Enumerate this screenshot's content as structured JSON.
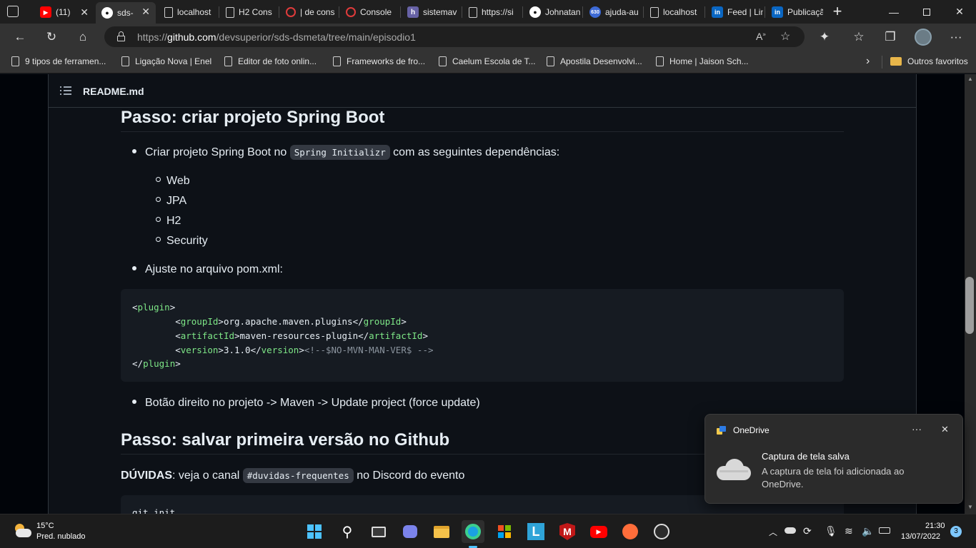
{
  "tabs": [
    {
      "label": "(11)",
      "icon": "youtube-icon",
      "color": "#ff0000"
    },
    {
      "label": "sds-",
      "icon": "github-icon",
      "color": "#ffffff",
      "active": true
    },
    {
      "label": "localhost",
      "icon": "page-icon"
    },
    {
      "label": "H2 Cons",
      "icon": "page-icon"
    },
    {
      "label": "| de cons",
      "icon": "devsuperior-icon",
      "color": "#e03b3b"
    },
    {
      "label": "Console",
      "icon": "devsuperior-icon",
      "color": "#e03b3b"
    },
    {
      "label": "sistemav",
      "icon": "heroku-icon",
      "color": "#6762a6"
    },
    {
      "label": "https://si",
      "icon": "page-icon"
    },
    {
      "label": "Johnatan",
      "icon": "github-icon",
      "color": "#ffffff"
    },
    {
      "label": "ajuda-au",
      "icon": "badge-630-icon",
      "color": "#3d6ad6",
      "badge": "630"
    },
    {
      "label": "localhost",
      "icon": "page-icon"
    },
    {
      "label": "Feed | Lin",
      "icon": "linkedin-icon",
      "color": "#0a66c2"
    },
    {
      "label": "Publicaçã",
      "icon": "linkedin-icon",
      "color": "#0a66c2"
    }
  ],
  "address": {
    "prefix": "https://",
    "domain": "github.com",
    "path": "/devsuperior/sds-dsmeta/tree/main/episodio1"
  },
  "favorites": [
    "9 tipos de ferramen...",
    "Ligação Nova | Enel",
    "Editor de foto onlin...",
    "Frameworks de fro...",
    "Caelum Escola de T...",
    "Apostila Desenvolvi...",
    "Home | Jaison Sch..."
  ],
  "favorites_other": "Outros favoritos",
  "readme": {
    "filename": "README.md",
    "section1": {
      "heading": "Passo: criar projeto Spring Boot",
      "item1_pre": "Criar projeto Spring Boot no ",
      "item1_code": "Spring Initializr",
      "item1_post": " com as seguintes dependências:",
      "deps": [
        "Web",
        "JPA",
        "H2",
        "Security"
      ],
      "item2": "Ajuste no arquivo pom.xml:",
      "code": {
        "plugin_open": "plugin",
        "group_tag": "groupId",
        "group_val": "org.apache.maven.plugins",
        "artifact_tag": "artifactId",
        "artifact_val": "maven-resources-plugin",
        "version_tag": "version",
        "version_val": "3.1.0",
        "comment": "<!--$NO-MVN-MAN-VER$ -->"
      },
      "item3": "Botão direito no projeto -> Maven -> Update project (force update)"
    },
    "section2": {
      "heading": "Passo: salvar primeira versão no Github",
      "doubts_bold": "DÚVIDAS",
      "doubts_pre": ": veja o canal ",
      "doubts_code": "#duvidas-frequentes",
      "doubts_post": " no Discord do evento",
      "code_first_line": "git init"
    }
  },
  "toast": {
    "app": "OneDrive",
    "title": "Captura de tela salva",
    "body": "A captura de tela foi adicionada ao OneDrive.",
    "more": "···",
    "close": "✕"
  },
  "taskbar": {
    "weather_temp": "15°C",
    "weather_desc": "Pred. nublado",
    "time": "21:30",
    "date": "13/07/2022",
    "notifications": "3"
  }
}
